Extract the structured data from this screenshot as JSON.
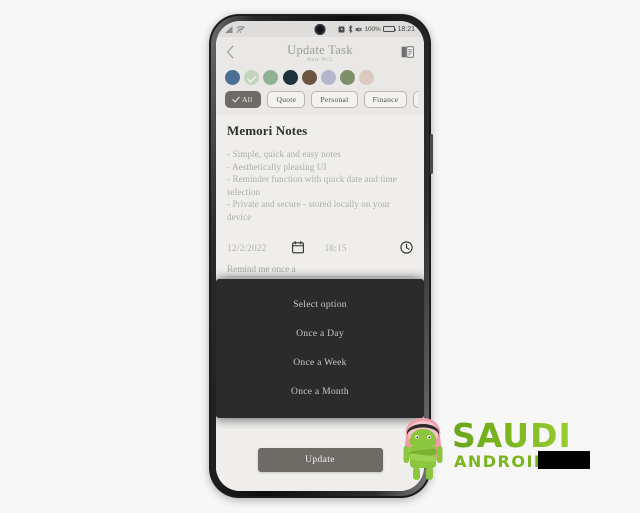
{
  "device": {
    "status_bar": {
      "signal_icon": "signal-bars-icon",
      "wifi_icon": "wifi-off-icon",
      "alarm_icon": "alarm-icon",
      "bluetooth_icon": "bluetooth-icon",
      "mute_icon": "volume-mute-icon",
      "battery_percent": "100%",
      "battery_icon": "battery-full-icon",
      "time": "18:21",
      "camera_notch": "front-camera-icon"
    }
  },
  "app_bar": {
    "back_icon": "chevron-left-icon",
    "title": "Update Task",
    "subtitle": "Note Nr:5",
    "notes_icon": "book-notes-icon"
  },
  "colors": {
    "swatches": [
      {
        "name": "steel-blue",
        "hex": "#4a6f93",
        "selected": false
      },
      {
        "name": "pale-green",
        "hex": "#c3d4bd",
        "selected": true
      },
      {
        "name": "sage-green",
        "hex": "#90b294",
        "selected": false
      },
      {
        "name": "dark-navy",
        "hex": "#1e323c",
        "selected": false
      },
      {
        "name": "brown",
        "hex": "#6b5541",
        "selected": false
      },
      {
        "name": "lavender-gray",
        "hex": "#b4b7cb",
        "selected": false
      },
      {
        "name": "olive-green",
        "hex": "#7f8f6c",
        "selected": false
      },
      {
        "name": "pink-beige",
        "hex": "#ddc9c1",
        "selected": false
      }
    ],
    "accent": "#6d6b66",
    "dialog_background": "#2b2b2b",
    "screen_background": "#efeeec"
  },
  "category_chips": [
    {
      "label": "All",
      "selected": true,
      "check_icon": "check-icon"
    },
    {
      "label": "Quote",
      "selected": false
    },
    {
      "label": "Personal",
      "selected": false
    },
    {
      "label": "Finance",
      "selected": false
    }
  ],
  "note": {
    "title": "Memori Notes",
    "body": "- Simple, quick and easy notes\n- Aesthetically pleasing UI\n- Reminder function with quick date and time selection\n- Private and secure - stored locally on your device"
  },
  "reminder": {
    "date": "12/2/2022",
    "calendar_icon": "calendar-icon",
    "time": "18:15",
    "clock_icon": "clock-icon",
    "repeat_label": "Remind me once a"
  },
  "dialog": {
    "header": "Select option",
    "options": [
      "Once a Day",
      "Once a Week",
      "Once a Month"
    ]
  },
  "footer": {
    "update_label": "Update"
  },
  "watermark": {
    "text_primary": "SAUDI",
    "text_secondary": "ANDROID",
    "mascot_icon": "android-mascot-keffiyeh-icon",
    "redaction_bar": "redaction-bar"
  }
}
